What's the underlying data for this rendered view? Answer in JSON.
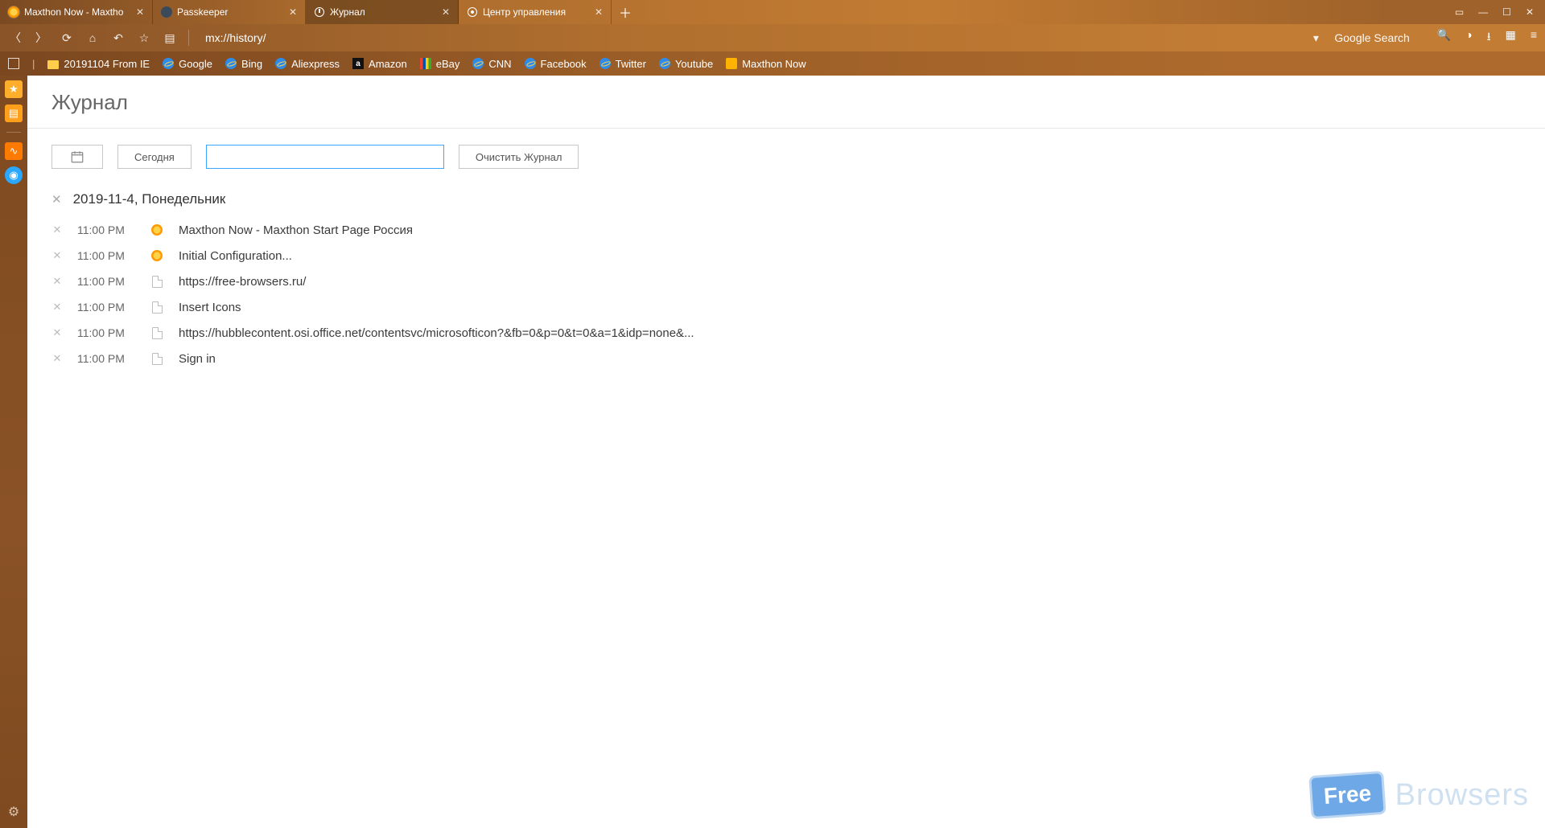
{
  "tabs": [
    {
      "label": "Maxthon Now - Maxtho",
      "icon": "sun"
    },
    {
      "label": "Passkeeper",
      "icon": "key"
    },
    {
      "label": "Журнал",
      "icon": "history",
      "active": true
    },
    {
      "label": "Центр управления",
      "icon": "gear"
    }
  ],
  "toolbar": {
    "url": "mx://history/",
    "search_engine": "Google Search"
  },
  "bookmarks": [
    {
      "label": "20191104 From IE",
      "icon": "folder"
    },
    {
      "label": "Google",
      "icon": "ie"
    },
    {
      "label": "Bing",
      "icon": "ie"
    },
    {
      "label": "Aliexpress",
      "icon": "ie"
    },
    {
      "label": "Amazon",
      "icon": "amazon"
    },
    {
      "label": "eBay",
      "icon": "ebay"
    },
    {
      "label": "CNN",
      "icon": "ie"
    },
    {
      "label": "Facebook",
      "icon": "ie"
    },
    {
      "label": "Twitter",
      "icon": "ie"
    },
    {
      "label": "Youtube",
      "icon": "ie"
    },
    {
      "label": "Maxthon Now",
      "icon": "mx"
    }
  ],
  "page": {
    "title": "Журнал",
    "today_btn": "Сегодня",
    "clear_btn": "Очистить Журнал",
    "search_value": ""
  },
  "history": {
    "date_label": "2019-11-4, Понедельник",
    "entries": [
      {
        "time": "11:00 PM",
        "icon": "sun",
        "title": "Maxthon Now - Maxthon Start Page Россия"
      },
      {
        "time": "11:00 PM",
        "icon": "sun",
        "title": "Initial Configuration..."
      },
      {
        "time": "11:00 PM",
        "icon": "page",
        "title": "https://free-browsers.ru/"
      },
      {
        "time": "11:00 PM",
        "icon": "page",
        "title": "Insert Icons"
      },
      {
        "time": "11:00 PM",
        "icon": "page",
        "title": "https://hubblecontent.osi.office.net/contentsvc/microsofticon?&fb=0&p=0&t=0&a=1&idp=none&..."
      },
      {
        "time": "11:00 PM",
        "icon": "page",
        "title": "Sign in"
      }
    ]
  },
  "watermark": {
    "free": "Free",
    "browsers": "Browsers"
  }
}
